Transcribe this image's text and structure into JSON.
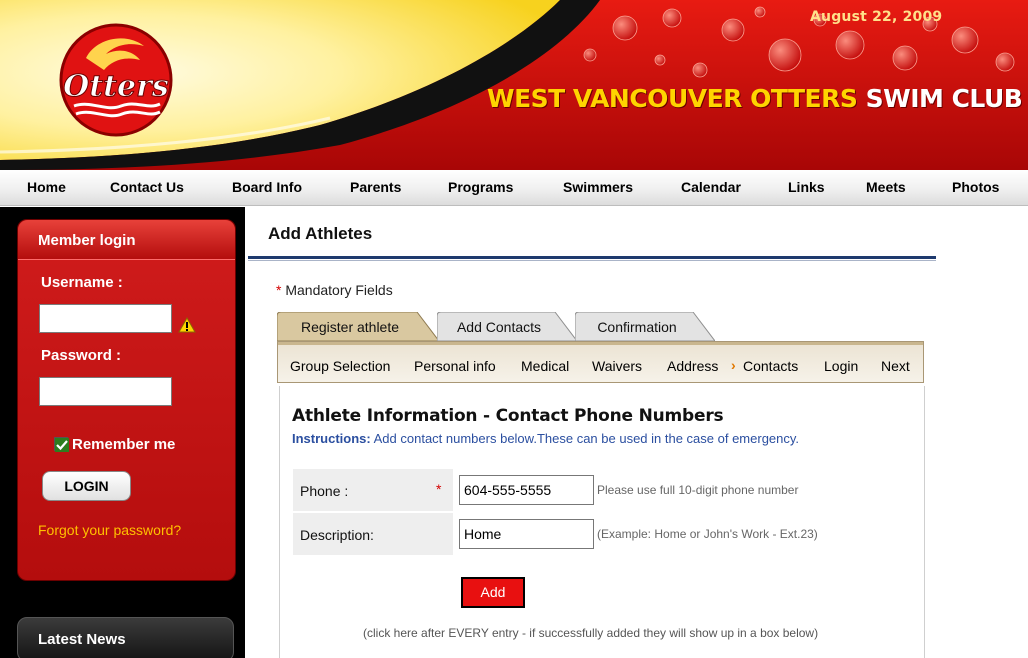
{
  "header": {
    "date": "August 22, 2009",
    "site_title_part1": "WEST VANCOUVER OTTERS",
    "site_title_part2": "SWIM CLUB",
    "logo_text": "Otters",
    "logo_icon": "otters-logo"
  },
  "nav": {
    "items": [
      "Home",
      "Contact Us",
      "Board Info",
      "Parents",
      "Programs",
      "Swimmers",
      "Calendar",
      "Links",
      "Meets",
      "Photos"
    ]
  },
  "sidebar": {
    "login_title": "Member login",
    "username_label": "Username :",
    "username_value": "",
    "password_label": "Password :",
    "password_value": "",
    "remember_label": "Remember me",
    "remember_checked": true,
    "login_button": "LOGIN",
    "forgot_link": "Forgot your password?",
    "news_title": "Latest News",
    "warning_icon": "warning-icon"
  },
  "main": {
    "page_title": "Add Athletes",
    "mandatory_star": "*",
    "mandatory_text": "Mandatory Fields",
    "tabs": [
      {
        "label": "Register athlete",
        "active": true
      },
      {
        "label": "Add Contacts",
        "active": false
      },
      {
        "label": "Confirmation",
        "active": false
      }
    ],
    "steps": [
      "Group Selection",
      "Personal info",
      "Medical",
      "Waivers",
      "Address",
      "Contacts",
      "Login",
      "Next"
    ],
    "current_step_arrow": "›",
    "section_title": "Athlete Information - Contact Phone Numbers",
    "instructions_label": "Instructions:",
    "instructions_text": " Add contact numbers below.These can be used in the case of emergency.",
    "phone_label": "Phone  :",
    "phone_required": "*",
    "phone_value": "604-555-5555",
    "phone_hint": "Please use full 10-digit phone number",
    "description_label": "Description:",
    "description_value": "Home",
    "description_hint": "(Example: Home or John's Work - Ext.23)",
    "add_button": "Add",
    "add_note": "(click here after EVERY entry - if successfully added they will show up in a box below)"
  },
  "colors": {
    "header_red": "#c40a0a",
    "header_yellow": "#ffd400",
    "sidebar_red": "#c41414",
    "accent_blue": "#1e3a6e",
    "add_button_red": "#e81010",
    "link_orange": "#ffc000"
  }
}
